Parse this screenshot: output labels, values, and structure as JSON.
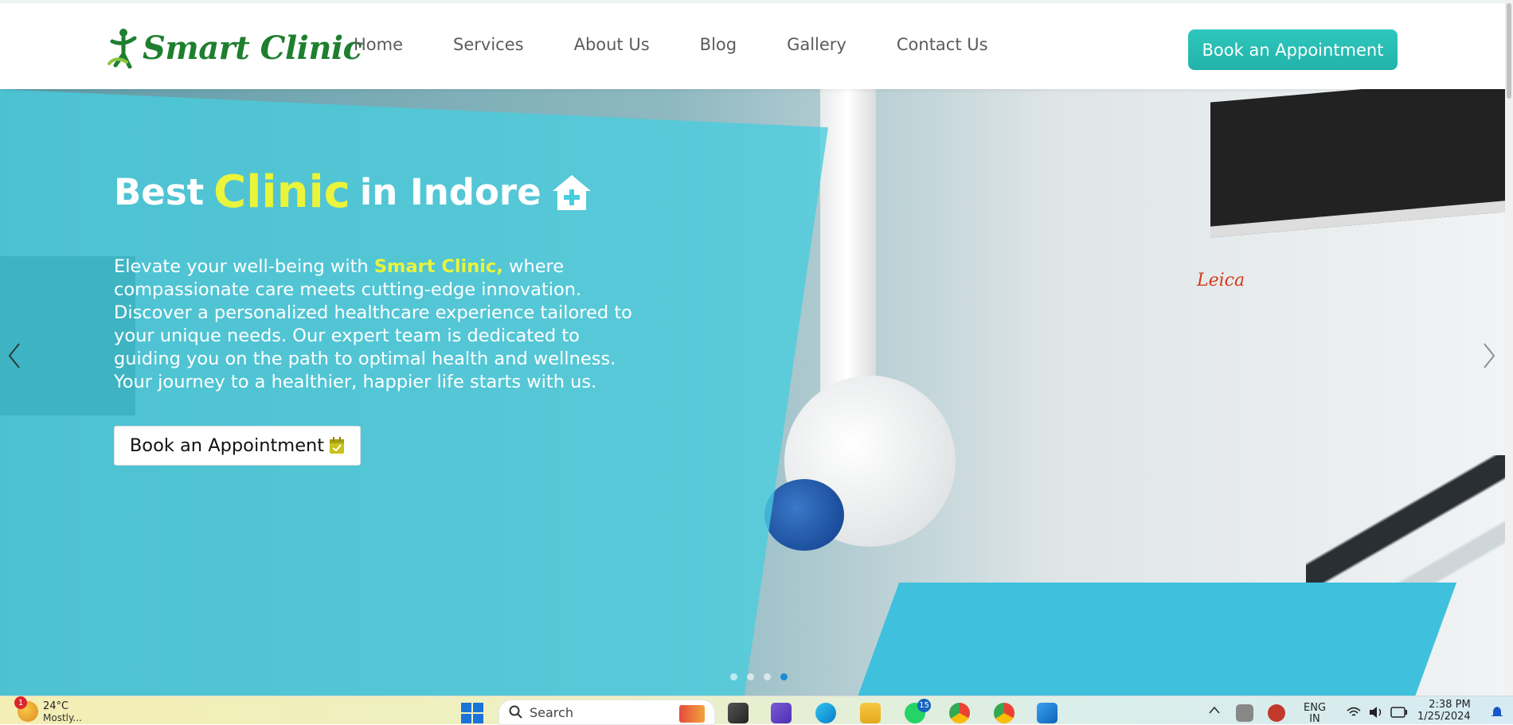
{
  "brand": {
    "name": "Smart Clinic"
  },
  "nav": {
    "items": [
      "Home",
      "Services",
      "About Us",
      "Blog",
      "Gallery",
      "Contact Us"
    ],
    "cta_label": "Book an Appointment"
  },
  "hero": {
    "title_prefix": "Best",
    "title_accent": "Clinic",
    "title_suffix": "in Indore",
    "desc_prefix": "Elevate your well-being with",
    "desc_brand": "Smart Clinic,",
    "desc_rest": "where compassionate care meets cutting-edge innovation. Discover a personalized healthcare experience tailored to your unique needs. Our expert team is dedicated to guiding you on the path to optimal health and wellness. Your journey to a healthier, happier life starts with us.",
    "button_label": "Book an Appointment",
    "photo_text": "Leica",
    "slides_total": 4,
    "active_slide": 4
  },
  "colors": {
    "accent_teal": "#22b3aa",
    "accent_yellow": "#eaf43a",
    "logo_green": "#1e7f2e",
    "overlay_cyan": "#48cdde"
  },
  "taskbar": {
    "weather_temp": "24°C",
    "weather_sub": "Mostly...",
    "weather_badge": "1",
    "search_placeholder": "Search",
    "whatsapp_badge": "15",
    "lang_top": "ENG",
    "lang_bottom": "IN",
    "time": "2:38 PM",
    "date": "1/25/2024"
  }
}
